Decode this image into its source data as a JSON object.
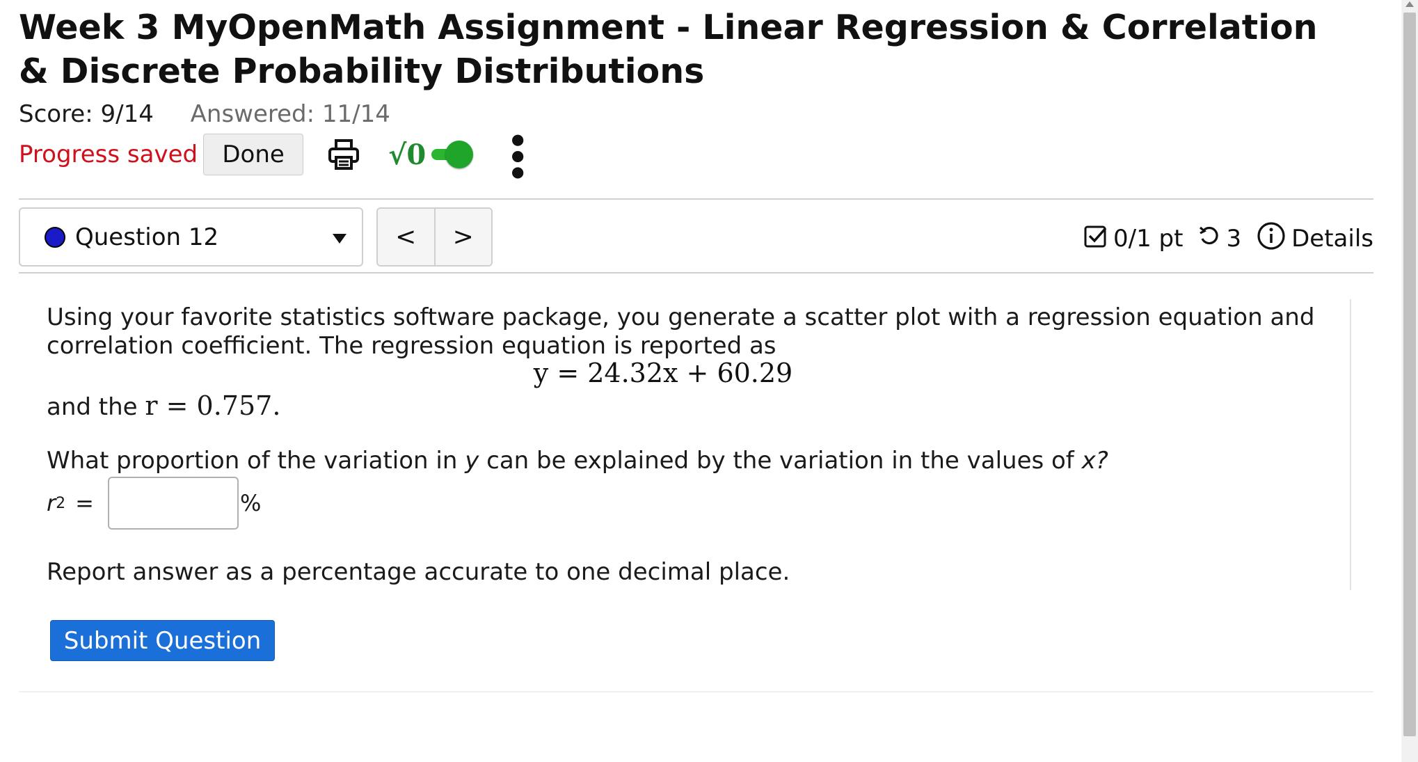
{
  "header": {
    "title": "Week 3 MyOpenMath Assignment - Linear Regression & Correlation & Discrete Probability Distributions",
    "score": "Score: 9/14",
    "answered": "Answered: 11/14",
    "progress_saved": "Progress saved",
    "done_label": "Done",
    "sqrt_label": "√0",
    "toggle_state": "on"
  },
  "question_nav": {
    "selected": "Question 12",
    "prev_label": "<",
    "next_label": ">",
    "points": "0/1 pt",
    "retries": "3",
    "details_label": "Details"
  },
  "question": {
    "intro": "Using your favorite statistics software package, you generate a scatter plot with a regression equation and correlation coefficient. The regression equation is reported as",
    "equation": "y = 24.32x + 60.29",
    "and_the": "and the",
    "r_expr": "r = 0.757.",
    "prompt_before_y": "What proportion of the variation in",
    "y_var": "y",
    "prompt_middle": "can be explained by the variation in the values of",
    "x_var": "x?",
    "answer_label": "r",
    "answer_sup": "2",
    "answer_eq": "=",
    "answer_value": "",
    "answer_unit": "%",
    "report": "Report answer as a percentage accurate to one decimal place.",
    "submit_label": "Submit Question"
  },
  "colors": {
    "progress_saved": "#d0101a",
    "submit_bg": "#1a6fd8",
    "toggle_green": "#1ea52a",
    "question_dot": "#1a1ac7"
  }
}
